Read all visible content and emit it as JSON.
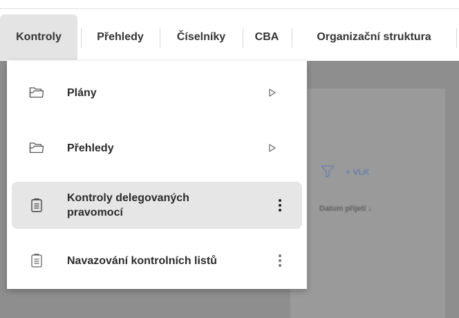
{
  "menubar": {
    "tabs": [
      {
        "label": "Kontroly",
        "active": true
      },
      {
        "label": "Přehledy"
      },
      {
        "label": "Číselníky"
      },
      {
        "label": "CBA"
      },
      {
        "label": "Organizační struktura"
      }
    ]
  },
  "background": {
    "toolbar_label": "VLK",
    "column_header": "Datum přijetí"
  },
  "dropdown": {
    "items": [
      {
        "label": "Plány",
        "icon": "folder-icon",
        "trailing": "submenu-arrow-icon"
      },
      {
        "label": "Přehledy",
        "icon": "folder-icon",
        "trailing": "submenu-arrow-icon"
      },
      {
        "label": "Kontroly delegovaných pravomocí",
        "icon": "clipboard-icon",
        "trailing": "more-vertical-icon",
        "selected": true
      },
      {
        "label": "Navazování kontrolních listů",
        "icon": "clipboard-icon",
        "trailing": "more-vertical-icon"
      }
    ]
  },
  "colors": {
    "active_tab_bg": "#e4e4e4",
    "selected_item_bg": "#e6e6e6",
    "backdrop": "#8e8e8e"
  }
}
